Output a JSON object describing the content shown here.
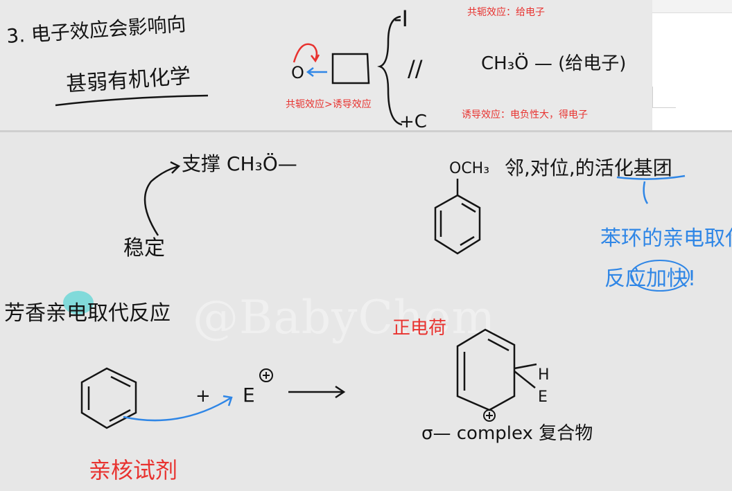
{
  "annotations": {
    "conjugation_donate": "共轭效应：给电子",
    "conjugation_gt_induction": "共轭效应>诱导效应",
    "induction_withdraw": "诱导效应：电负性大，得电子"
  },
  "handwriting": {
    "title_line1": "3. 电子效应会影响向",
    "title_line2": "甚弱有机化学",
    "o_label": "O",
    "minus_i": "-I",
    "eq": "//",
    "plus_c": "+C",
    "ch3o_donate": "CH₃Ö — (给电子)",
    "support": "支撑 CH₃Ö—",
    "stable": "稳定",
    "och3": "OCH₃",
    "op_activating": "邻,对位,的活化基团",
    "benzene_eas": "苯环的亲电取代",
    "rate_up": "反应加快!",
    "aromatic_eas": "芳香亲电取代反应",
    "plus": "+",
    "electrophile": "E",
    "h_label": "H",
    "e_label": "E",
    "positive_charge": "正电荷",
    "sigma_complex": "σ— complex 复合物",
    "nucleophile": "亲核试剂"
  },
  "watermark": "@BabyChem",
  "colors": {
    "ink": "#141414",
    "red": "#e8322f",
    "blue": "#2f86e6",
    "highlight": "#5fd6d6"
  }
}
